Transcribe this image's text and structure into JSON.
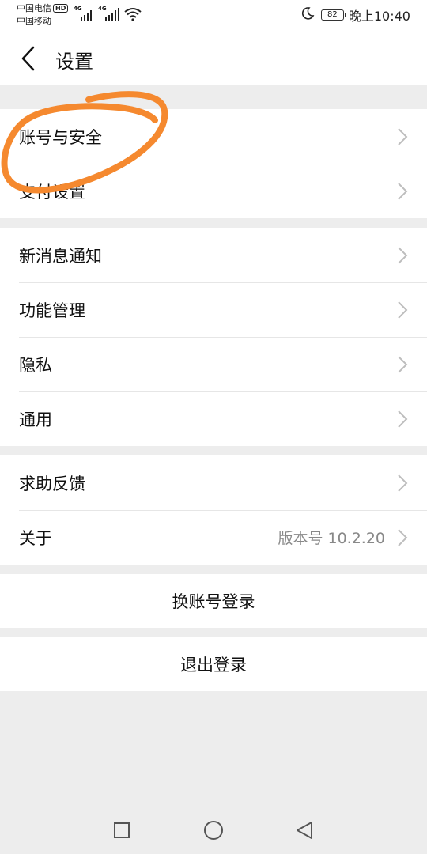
{
  "status_bar": {
    "carrier1": "中国电信",
    "carrier1_badge": "HD",
    "carrier2": "中国移动",
    "signal1_label": "4G",
    "signal2_label": "4G",
    "battery": "82",
    "time": "晚上10:40",
    "icons": [
      "signal-icon",
      "wifi-icon",
      "moon-icon",
      "battery-icon"
    ]
  },
  "header": {
    "title": "设置"
  },
  "sections": [
    {
      "items": [
        {
          "label": "账号与安全"
        },
        {
          "label": "支付设置"
        }
      ]
    },
    {
      "items": [
        {
          "label": "新消息通知"
        },
        {
          "label": "功能管理"
        },
        {
          "label": "隐私"
        },
        {
          "label": "通用"
        }
      ]
    },
    {
      "items": [
        {
          "label": "求助反馈"
        },
        {
          "label": "关于",
          "value": "版本号 10.2.20"
        }
      ]
    }
  ],
  "actions": {
    "switch_account": "换账号登录",
    "logout": "退出登录"
  },
  "colors": {
    "background": "#ededed",
    "annotation": "#f5892f",
    "secondary_text": "#888888"
  }
}
